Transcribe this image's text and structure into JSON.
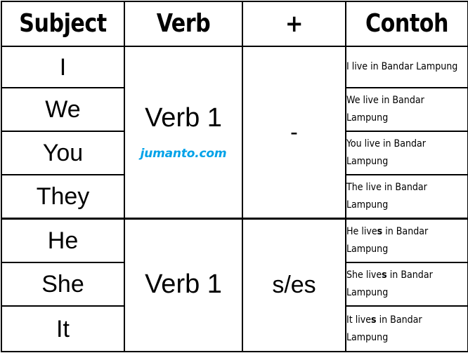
{
  "table": {
    "title": "Simple Present Tense formula table",
    "headers": [
      {
        "key": "subject",
        "label": "Subject"
      },
      {
        "key": "verb",
        "label": "Verb"
      },
      {
        "key": "plus",
        "label": "+"
      },
      {
        "key": "contoh",
        "label": "Contoh"
      }
    ],
    "sections": [
      {
        "id": "plural-section",
        "verb": "Verb 1",
        "sign": "-",
        "watermark": "jumanto.com",
        "rows": [
          {
            "subject": "I",
            "example_line1_pre": "I live in Bandar",
            "example_bold": "",
            "example_line1_post": "",
            "example_line2": "Lampung",
            "example_full": "I live in Bandar Lampung"
          },
          {
            "subject": "We",
            "example_line1_pre": "We live in Bandar",
            "example_bold": "",
            "example_line1_post": "",
            "example_line2": "Lampung",
            "example_full": "We live in Bandar Lampung"
          },
          {
            "subject": "You",
            "example_line1_pre": "You live in Bandar",
            "example_bold": "",
            "example_line1_post": "",
            "example_line2": "Lampung",
            "example_full": "You live in Bandar Lampung"
          },
          {
            "subject": "They",
            "example_line1_pre": "The live in Bandar",
            "example_bold": "",
            "example_line1_post": "",
            "example_line2": "Lampung",
            "example_full": "The live in Bandar Lampung"
          }
        ]
      },
      {
        "id": "singular-section",
        "verb": "Verb 1",
        "sign": "s/es",
        "watermark": "",
        "rows": [
          {
            "subject": "He",
            "example_line1_pre": "He live",
            "example_bold": "s",
            "example_line1_post": " in Bandar",
            "example_line2": "Lampung",
            "example_full": "He lives in Bandar Lampung"
          },
          {
            "subject": "She",
            "example_line1_pre": "She live",
            "example_bold": "s",
            "example_line1_post": " in",
            "example_line2": "Bandar Lampung",
            "example_full": "She lives in Bandar Lampung"
          },
          {
            "subject": "It",
            "example_line1_pre": "It live",
            "example_bold": "s",
            "example_line1_post": " in Bandar",
            "example_line2": "Lampung",
            "example_full": "It lives in Bandar Lampung"
          }
        ]
      }
    ]
  },
  "colors": {
    "grid": "#000000",
    "text": "#000000",
    "background": "#ffffff",
    "watermark": "#00a2e8"
  }
}
